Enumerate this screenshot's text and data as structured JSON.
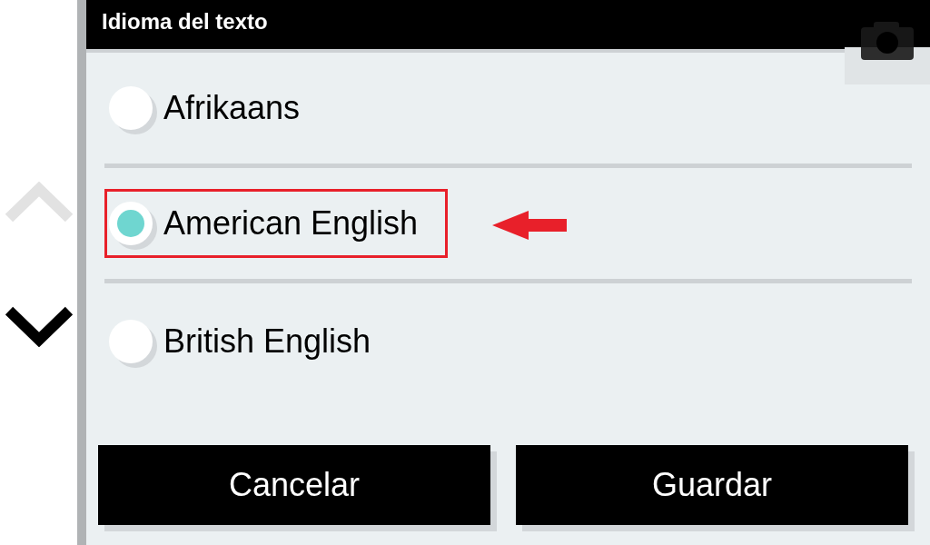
{
  "dialog": {
    "title": "Idioma del texto"
  },
  "scroll_up": {
    "disabled": true
  },
  "scroll_down": {
    "disabled": false
  },
  "options": [
    {
      "label": "Afrikaans",
      "selected": false,
      "highlighted": false
    },
    {
      "label": "American English",
      "selected": true,
      "highlighted": true
    },
    {
      "label": "British English",
      "selected": false,
      "highlighted": false
    }
  ],
  "buttons": [
    {
      "label": "Cancelar"
    },
    {
      "label": "Guardar"
    }
  ]
}
